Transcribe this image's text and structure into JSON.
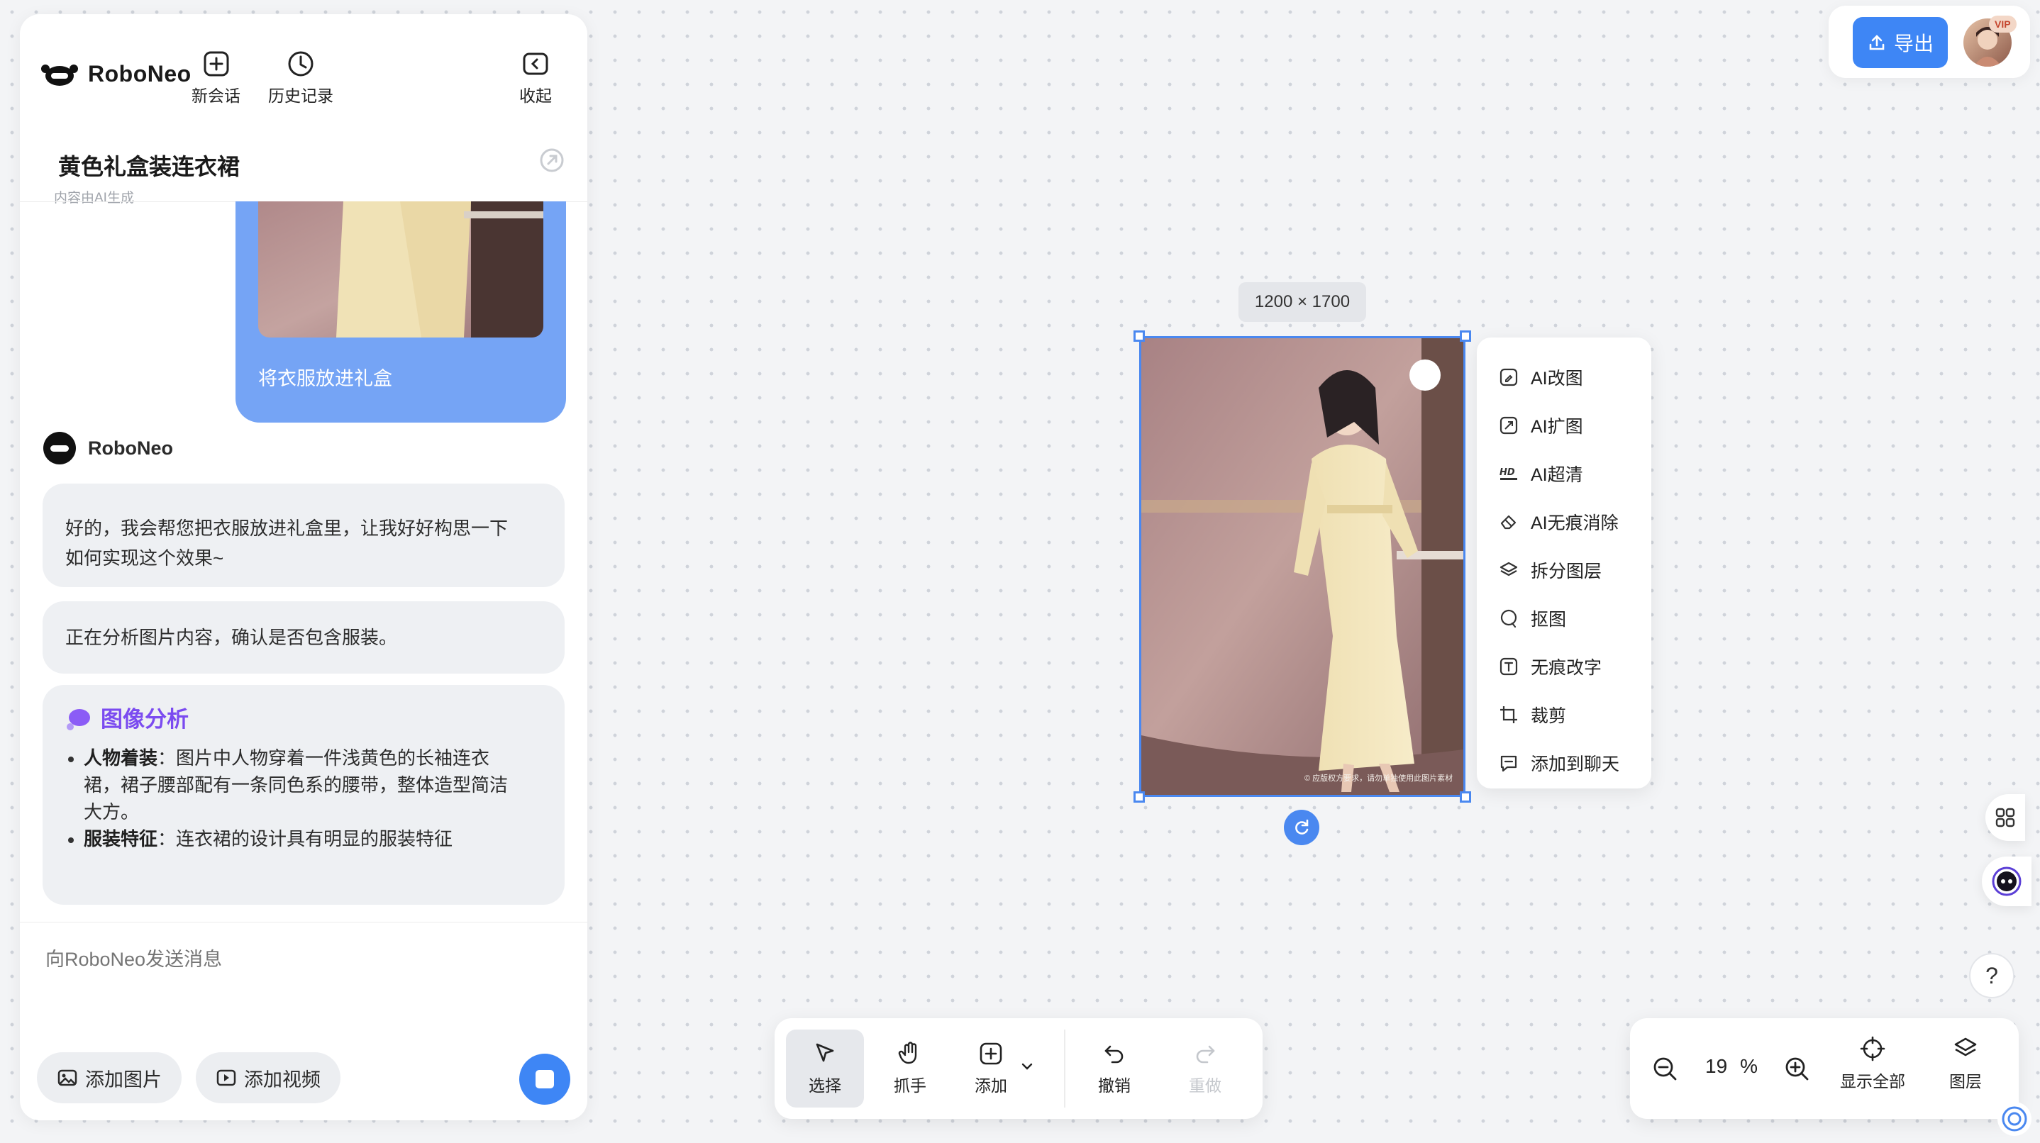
{
  "colors": {
    "accent": "#3e86f5",
    "user_bubble": "#75a4f5",
    "analysis_purple": "#7b4bf0",
    "selection": "#4a88f0"
  },
  "app": {
    "brand": "RoboNeo",
    "header_buttons": [
      {
        "icon": "plus-square-icon",
        "label": "新会话"
      },
      {
        "icon": "clock-icon",
        "label": "历史记录"
      },
      {
        "icon": "collapse-icon",
        "label": "收起"
      }
    ]
  },
  "conversation": {
    "title": "黄色礼盒装连衣裙",
    "subtitle": "内容由AI生成"
  },
  "messages": {
    "user_text": "将衣服放进礼盒",
    "bot_name": "RoboNeo",
    "bot_reply_1_line1": "好的，我会帮您把衣服放进礼盒里，让我好好构思一下",
    "bot_reply_1_line2": "如何实现这个效果~",
    "bot_reply_2": "正在分析图片内容，确认是否包含服装。",
    "analysis": {
      "title": "图像分析",
      "items": [
        {
          "label": "人物着装",
          "sep": "：",
          "text_line1": "图片中人物穿着一件浅黄色的长袖连衣",
          "text_line2": "裙，裙子腰部配有一条同色系的腰带，整体造型简洁",
          "text_line3": "大方。"
        },
        {
          "label": "服装特征",
          "sep": "：",
          "text_line1": "连衣裙的设计具有明显的服装特征"
        }
      ]
    }
  },
  "composer": {
    "placeholder": "向RoboNeo发送消息",
    "add_image": "添加图片",
    "add_video": "添加视频"
  },
  "canvas": {
    "image_dimensions": "1200 × 1700",
    "watermark": "© 应版权方要求，请勿单独使用此图片素材"
  },
  "context_menu": [
    {
      "icon": "ai-edit-icon",
      "label": "AI改图"
    },
    {
      "icon": "ai-expand-icon",
      "label": "AI扩图"
    },
    {
      "icon": "hd-icon",
      "label": "AI超清"
    },
    {
      "icon": "eraser-icon",
      "label": "AI无痕消除"
    },
    {
      "icon": "layers-split-icon",
      "label": "拆分图层"
    },
    {
      "icon": "cutout-icon",
      "label": "抠图"
    },
    {
      "icon": "text-edit-icon",
      "label": "无痕改字"
    },
    {
      "icon": "crop-icon",
      "label": "裁剪"
    },
    {
      "icon": "chat-add-icon",
      "label": "添加到聊天"
    }
  ],
  "top_right": {
    "export_label": "导出",
    "vip": "VIP"
  },
  "toolbar": {
    "select": "选择",
    "hand": "抓手",
    "add": "添加",
    "undo": "撤销",
    "redo": "重做"
  },
  "zoom": {
    "value": "19",
    "unit": "%",
    "fit_all": "显示全部",
    "layers": "图层"
  },
  "help": "?"
}
